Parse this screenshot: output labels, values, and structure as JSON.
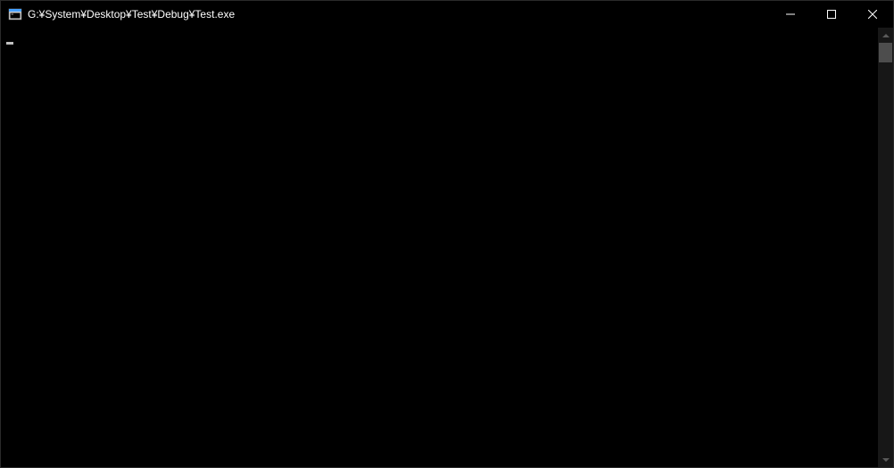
{
  "window": {
    "title": "G:¥System¥Desktop¥Test¥Debug¥Test.exe"
  },
  "console": {
    "lines": [
      ""
    ]
  }
}
